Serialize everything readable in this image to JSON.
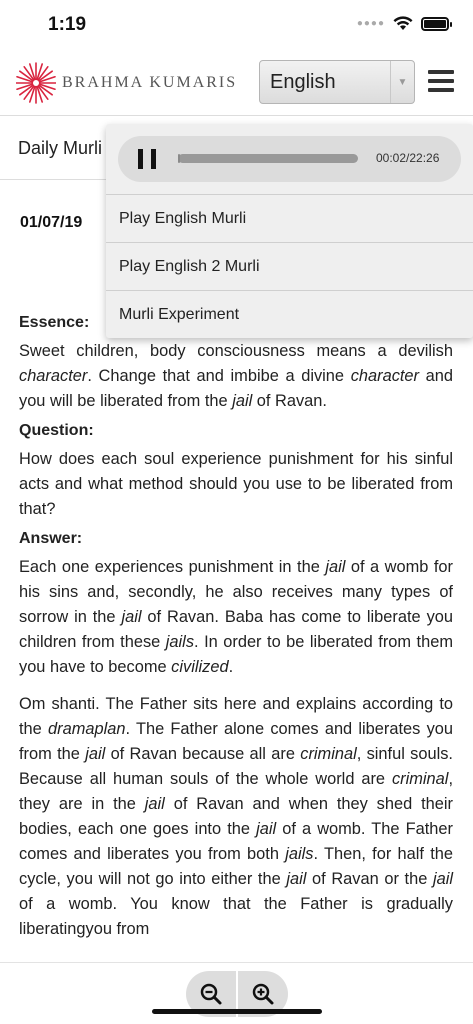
{
  "status_bar": {
    "time": "1:19"
  },
  "header": {
    "brand": "Brahma Kumaris",
    "brand_display": "BRAHMA KUMARIS",
    "language": "English"
  },
  "subheader": {
    "title": "Daily Murli"
  },
  "audio": {
    "time": "00:02/22:26",
    "progress": 0.0015,
    "items": [
      "Play English Murli",
      "Play English 2 Murli",
      "Murli Experiment"
    ]
  },
  "article": {
    "date": "01/07/19",
    "essence_label": "Essence:",
    "essence": "Sweet children, body consciousness means a devilish character. Change that and imbibe a divine character and you will be liberated from the jail of Ravan.",
    "question_label": "Question:",
    "question": "How does each soul experience punishment for his sinful acts and what method should you use to be liberated from that?",
    "answer_label": "Answer:",
    "answer": "Each one experiences punishment in the jail of a womb for his sins and, secondly, he also receives many types of sorrow in the jail of Ravan. Baba has come to liberate you children from these jails. In order to be liberated from them you have to become civilized.",
    "body": "Om shanti. The Father sits here and explains according to the dramaplan. The Father alone comes and liberates you from the jail of Ravan because all are criminal, sinful souls. Because all human souls of the whole world are criminal, they are in the jail of Ravan and when they shed their bodies, each one goes into the jail of a womb. The Father comes and liberates you from both jails. Then, for half the cycle, you will not go into either the jail of Ravan or the jail of a womb. You know that the Father is gradually liberatingyou from"
  },
  "colors": {
    "brand_red": "#d9243f",
    "panel_bg": "#efefef",
    "player_bg": "#dcdcdc"
  },
  "icons": {
    "zoom_out": "zoom-out-icon",
    "zoom_in": "zoom-in-icon",
    "menu": "hamburger-menu-icon"
  }
}
